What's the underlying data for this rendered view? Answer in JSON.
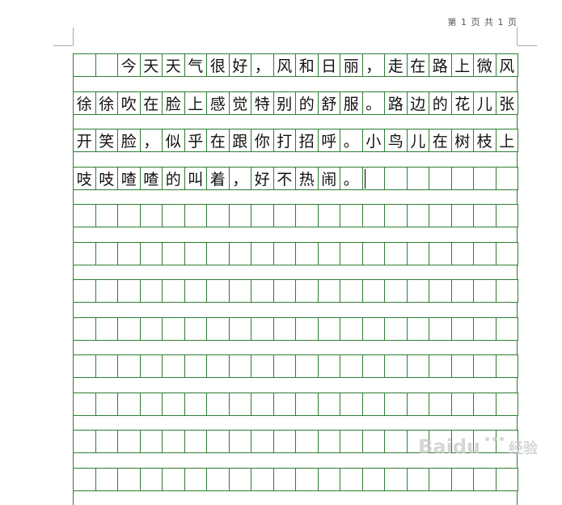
{
  "header": {
    "page_indicator": "第 1 页 共 1 页"
  },
  "document": {
    "columns": 20,
    "rows": 12,
    "text_rows": [
      [
        "",
        "",
        "今",
        "天",
        "天",
        "气",
        "很",
        "好",
        "，",
        "风",
        "和",
        "日",
        "丽",
        "，",
        "走",
        "在",
        "路",
        "上",
        "微",
        "风"
      ],
      [
        "徐",
        "徐",
        "吹",
        "在",
        "脸",
        "上",
        "感",
        "觉",
        "特",
        "别",
        "的",
        "舒",
        "服",
        "。",
        "路",
        "边",
        "的",
        "花",
        "儿",
        "张"
      ],
      [
        "开",
        "笑",
        "脸",
        "，",
        "似",
        "乎",
        "在",
        "跟",
        "你",
        "打",
        "招",
        "呼",
        "。",
        "小",
        "鸟",
        "儿",
        "在",
        "树",
        "枝",
        "上"
      ],
      [
        "吱",
        "吱",
        "喳",
        "喳",
        "的",
        "叫",
        "着",
        "，",
        "好",
        "不",
        "热",
        "闹",
        "。",
        "",
        "",
        "",
        "",
        "",
        "",
        ""
      ]
    ],
    "caret": {
      "row": 3,
      "col": 13
    }
  },
  "watermark": {
    "logo_text": "Baidu",
    "suffix": "经验"
  },
  "colors": {
    "grid_line": "#2e7d32",
    "text": "#111111",
    "page_bg": "#ffffff"
  }
}
